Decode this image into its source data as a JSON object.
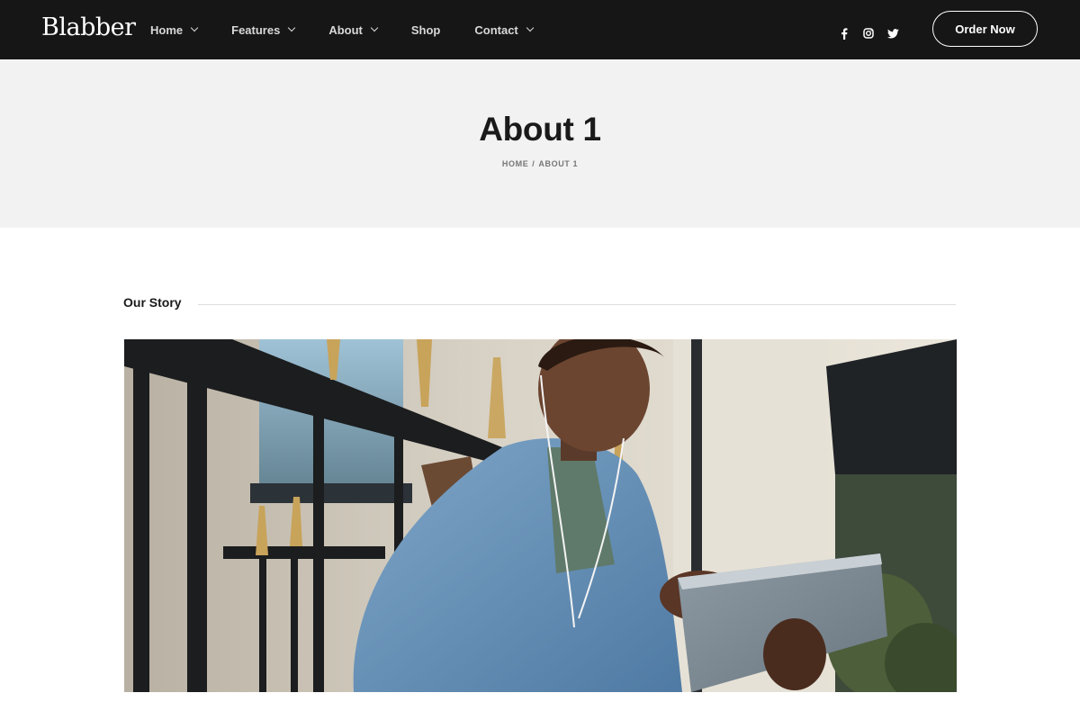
{
  "header": {
    "logo": "Blabber",
    "nav": [
      {
        "label": "Home",
        "dropdown": true
      },
      {
        "label": "Features",
        "dropdown": true
      },
      {
        "label": "About",
        "dropdown": true
      },
      {
        "label": "Shop",
        "dropdown": false
      },
      {
        "label": "Contact",
        "dropdown": true
      }
    ],
    "social": [
      "facebook-icon",
      "instagram-icon",
      "twitter-icon"
    ],
    "order_button": "Order Now"
  },
  "title_band": {
    "title": "About 1",
    "breadcrumb": {
      "home": "HOME",
      "separator": "/",
      "current": "ABOUT 1"
    }
  },
  "story": {
    "label": "Our Story"
  },
  "colors": {
    "header_bg": "#161616",
    "band_bg": "#f2f2f2",
    "accent_text": "#1a1a1a"
  }
}
